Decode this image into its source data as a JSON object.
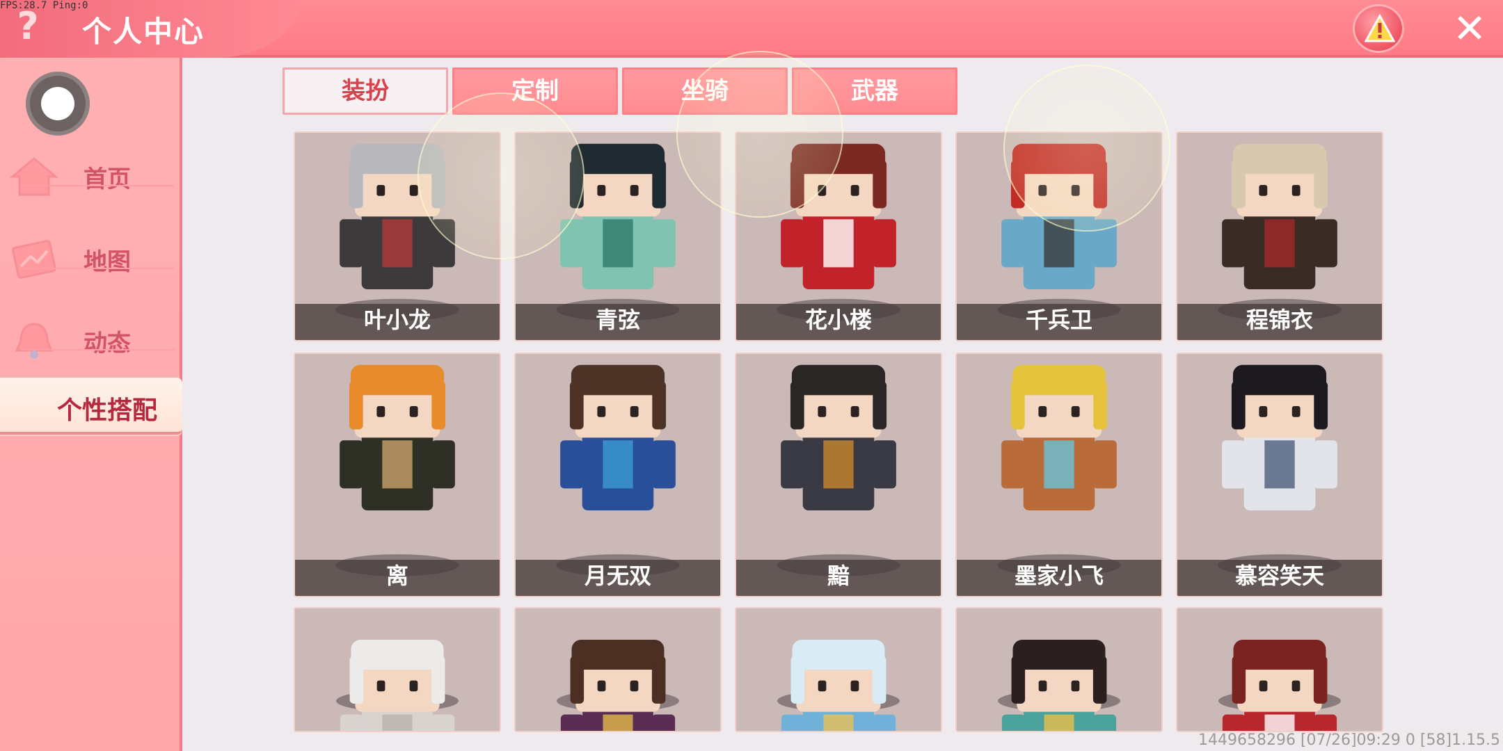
{
  "debug": {
    "fps_text": "FPS:28.7  Ping:0"
  },
  "header": {
    "title": "个人中心",
    "help_icon": "help-icon",
    "alert_icon": "warning-icon",
    "close_icon": "close-icon",
    "close_glyph": "✕",
    "help_glyph": "?"
  },
  "sidebar": {
    "items": [
      {
        "label": "首页",
        "icon": "home-icon"
      },
      {
        "label": "地图",
        "icon": "map-icon"
      },
      {
        "label": "动态",
        "icon": "bell-icon"
      },
      {
        "label": "个性搭配",
        "icon": "outfit-icon",
        "active": true
      }
    ]
  },
  "tabs": [
    {
      "label": "装扮",
      "active": true
    },
    {
      "label": "定制"
    },
    {
      "label": "坐骑"
    },
    {
      "label": "武器"
    }
  ],
  "cards": [
    {
      "name": "叶小龙",
      "hair": "#b8b8bc",
      "body": "#3d3a3c",
      "accent": "#b23a3a"
    },
    {
      "name": "青弦",
      "hair": "#1f2b31",
      "body": "#7fc3b0",
      "accent": "#2f7b6c"
    },
    {
      "name": "花小楼",
      "hair": "#7a2a22",
      "body": "#c2232b",
      "accent": "#ffffff"
    },
    {
      "name": "千兵卫",
      "hair": "#c22a25",
      "body": "#6aa8c7",
      "accent": "#3b3b3b"
    },
    {
      "name": "程锦衣",
      "hair": "#d7c8b0",
      "body": "#3b2b25",
      "accent": "#a32a2a"
    },
    {
      "name": "离",
      "hair": "#e78b2c",
      "body": "#2e2f25",
      "accent": "#c9a36b"
    },
    {
      "name": "月无双",
      "hair": "#4c3326",
      "body": "#2a4f9a",
      "accent": "#3b9ad1"
    },
    {
      "name": "黯",
      "hair": "#2a2626",
      "body": "#3a3a44",
      "accent": "#c9862f"
    },
    {
      "name": "墨家小飞",
      "hair": "#e5c23b",
      "body": "#b96b3a",
      "accent": "#6ac3d8"
    },
    {
      "name": "慕容笑天",
      "hair": "#1c1a1e",
      "body": "#e3e3ea",
      "accent": "#4b5d7a"
    },
    {
      "name": "",
      "hair": "#ecebea",
      "body": "#d9d3d0",
      "accent": "#b9b2ad"
    },
    {
      "name": "",
      "hair": "#4b2f22",
      "body": "#5a2d55",
      "accent": "#e0b84a"
    },
    {
      "name": "",
      "hair": "#d9ecf5",
      "body": "#6fb1d8",
      "accent": "#e8c35a"
    },
    {
      "name": "",
      "hair": "#2b1f1f",
      "body": "#4aa29a",
      "accent": "#e7c14b"
    },
    {
      "name": "",
      "hair": "#7a2320",
      "body": "#b8272d",
      "accent": "#ffffff"
    }
  ],
  "footer": {
    "info_text": "1449658296    [07/26]09:29 0    [58]1.15.5"
  }
}
